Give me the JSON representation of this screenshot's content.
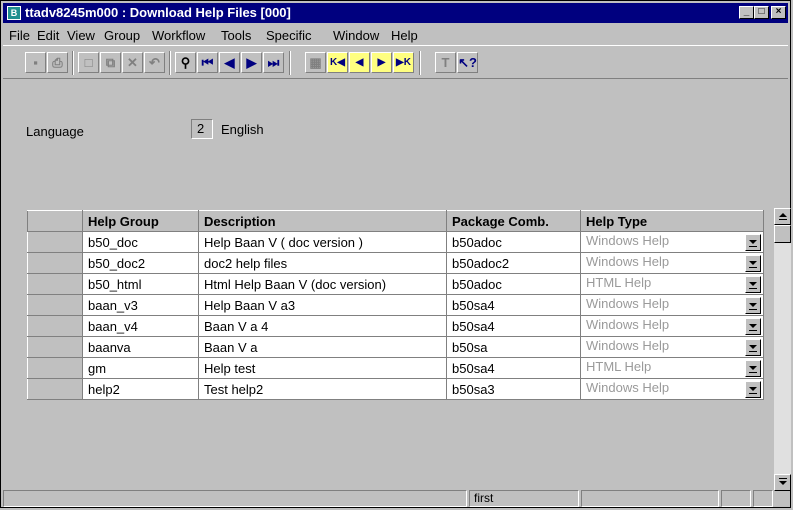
{
  "window": {
    "title": "ttadv8245m000 : Download Help Files [000]",
    "min_label": "_",
    "max_label": "□",
    "close_label": "×"
  },
  "menubar": [
    "File",
    "Edit",
    "View",
    "Group",
    "Workflow",
    "Tools",
    "Specific",
    "Window",
    "Help"
  ],
  "form": {
    "language_label": "Language",
    "language_code": "2",
    "language_name": "English"
  },
  "grid": {
    "columns": [
      "Help Group",
      "Description",
      "Package Comb.",
      "Help Type"
    ],
    "rows": [
      {
        "help_group": "b50_doc",
        "description": "Help Baan V  ( doc version )",
        "package": "b50adoc",
        "help_type": "Windows Help"
      },
      {
        "help_group": "b50_doc2",
        "description": "doc2 help files",
        "package": "b50adoc2",
        "help_type": "Windows Help"
      },
      {
        "help_group": "b50_html",
        "description": "Html Help Baan V (doc version)",
        "package": "b50adoc",
        "help_type": "HTML Help"
      },
      {
        "help_group": "baan_v3",
        "description": "Help Baan V a3",
        "package": "b50sa4",
        "help_type": "Windows Help"
      },
      {
        "help_group": "baan_v4",
        "description": "Baan V a 4",
        "package": "b50sa4",
        "help_type": "Windows Help"
      },
      {
        "help_group": "baanva",
        "description": "Baan V a",
        "package": "b50sa",
        "help_type": "Windows Help"
      },
      {
        "help_group": "gm",
        "description": "Help test",
        "package": "b50sa4",
        "help_type": "HTML Help"
      },
      {
        "help_group": "help2",
        "description": "Test help2",
        "package": "b50sa3",
        "help_type": "Windows Help"
      }
    ]
  },
  "statusbar": {
    "position_text": "first"
  },
  "colors": {
    "titlebar": "#00007f",
    "face": "#c0c0c0",
    "disabled_text": "#9a9a9a",
    "accent_icon": "#ffff80"
  }
}
